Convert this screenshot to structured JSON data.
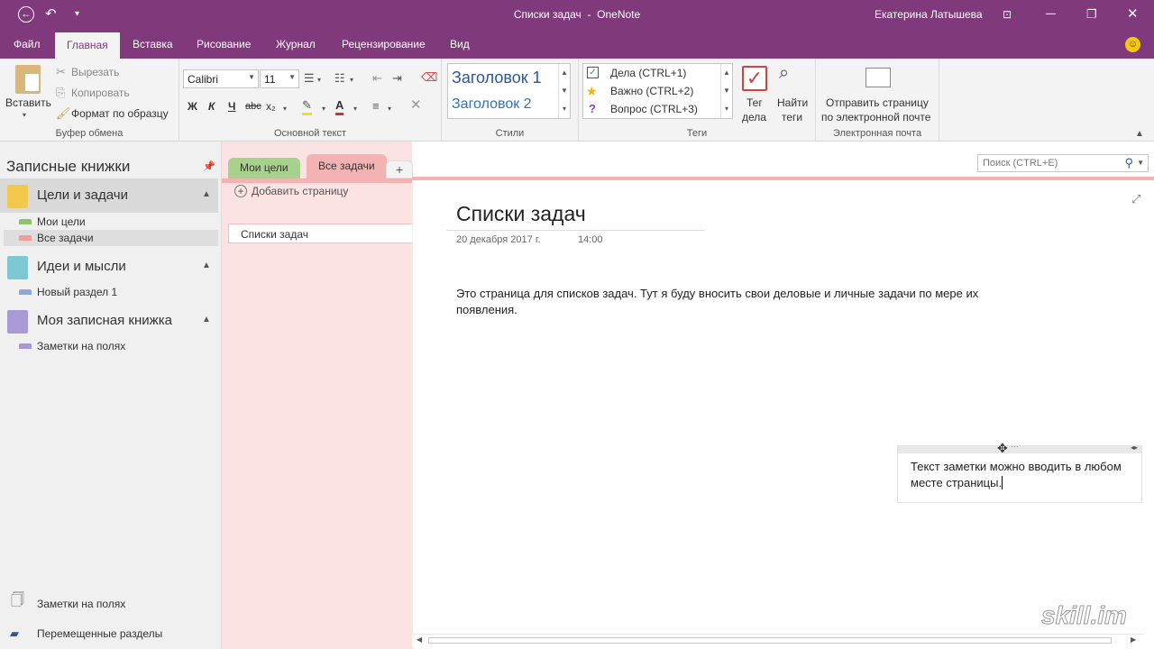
{
  "window": {
    "title": "Списки задач",
    "title_sep": "-",
    "app": "OneNote",
    "user": "Екатерина Латышева"
  },
  "ribbon_tabs": [
    "Файл",
    "Главная",
    "Вставка",
    "Рисование",
    "Журнал",
    "Рецензирование",
    "Вид"
  ],
  "clipboard": {
    "paste": "Вставить",
    "cut": "Вырезать",
    "copy": "Копировать",
    "format_painter": "Формат по образцу",
    "label": "Буфер обмена"
  },
  "basic_text": {
    "font": "Calibri",
    "size": "11",
    "bold": "Ж",
    "italic": "К",
    "underline": "Ч",
    "strike": "abc",
    "subscript": "x₂",
    "label": "Основной текст"
  },
  "styles": {
    "h1": "Заголовок 1",
    "h2": "Заголовок 2",
    "label": "Стили"
  },
  "tags": {
    "items": [
      "Дела (CTRL+1)",
      "Важно (CTRL+2)",
      "Вопрос (CTRL+3)"
    ],
    "todo_tag_l1": "Тег",
    "todo_tag_l2": "дела",
    "find_tags_l1": "Найти",
    "find_tags_l2": "теги",
    "label": "Теги"
  },
  "email": {
    "send_l1": "Отправить страницу",
    "send_l2": "по электронной почте",
    "label": "Электронная почта"
  },
  "left_pane": {
    "header": "Записные книжки",
    "notebooks": [
      {
        "name": "Цели и задачи",
        "color": "#f2c94c",
        "sections": [
          {
            "name": "Мои цели",
            "color": "#8dc26f"
          },
          {
            "name": "Все задачи",
            "color": "#f29b9b"
          }
        ]
      },
      {
        "name": "Идеи и мысли",
        "color": "#7ec8d6",
        "sections": [
          {
            "name": "Новый раздел 1",
            "color": "#8fa8dc"
          }
        ]
      },
      {
        "name": "Моя записная книжка",
        "color": "#a99ad6",
        "sections": [
          {
            "name": "Заметки на полях",
            "color": "#a99ad6"
          }
        ]
      }
    ],
    "bottom": [
      "Заметки на полях",
      "Перемещенные разделы"
    ]
  },
  "section_tabs": [
    "Мои цели",
    "Все задачи",
    "+"
  ],
  "pages": {
    "add_label": "Добавить страницу",
    "items": [
      "Списки задач"
    ]
  },
  "search": {
    "placeholder": "Поиск (CTRL+E)"
  },
  "page": {
    "title": "Списки задач",
    "date": "20 декабря 2017 г.",
    "time": "14:00",
    "body": "Это страница для списков задач. Тут я буду вносить свои деловые и личные задачи по мере их появления.",
    "note": "Текст заметки можно вводить в любом месте страницы."
  },
  "watermark": "skill.im"
}
